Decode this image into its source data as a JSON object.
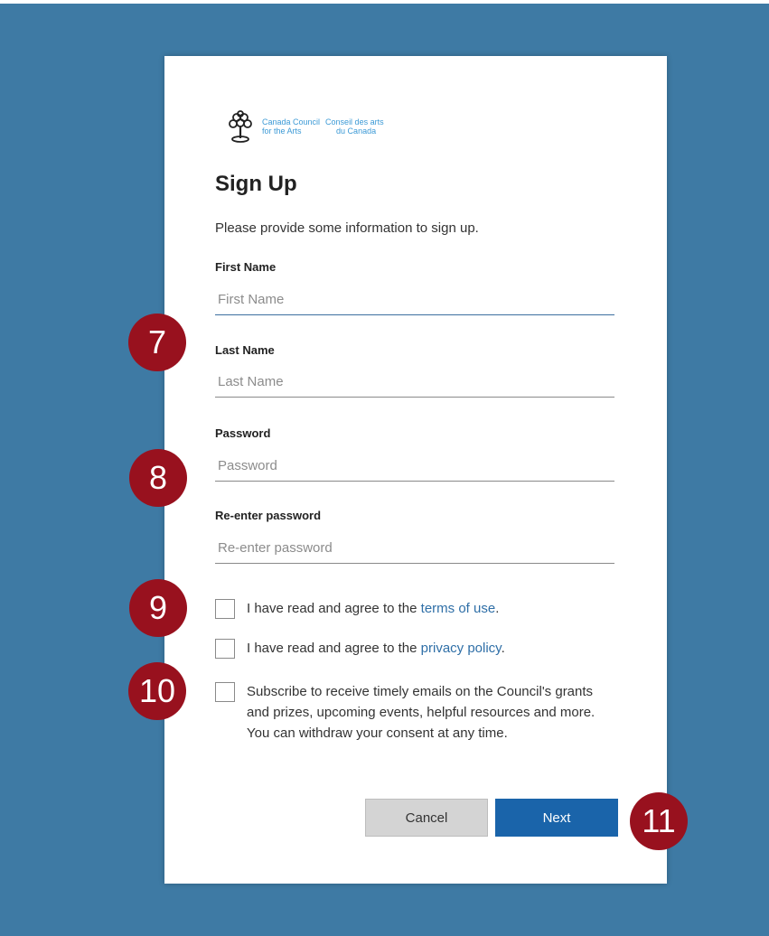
{
  "branding": {
    "logo_text_en_line1": "Canada Council",
    "logo_text_en_line2": "for the Arts",
    "logo_text_fr_line1": "Conseil des arts",
    "logo_text_fr_line2": "du Canada"
  },
  "form": {
    "title": "Sign Up",
    "intro": "Please provide some information to sign up.",
    "first_name": {
      "label": "First Name",
      "placeholder": "First Name",
      "value": ""
    },
    "last_name": {
      "label": "Last Name",
      "placeholder": "Last Name",
      "value": ""
    },
    "password": {
      "label": "Password",
      "placeholder": "Password",
      "value": ""
    },
    "reenter_password": {
      "label": "Re-enter password",
      "placeholder": "Re-enter password",
      "value": ""
    },
    "terms": {
      "prefix": "I have read and agree to the ",
      "link": "terms of use",
      "suffix": ".",
      "checked": false
    },
    "privacy": {
      "prefix": "I have read and agree to the ",
      "link": "privacy policy",
      "suffix": ".",
      "checked": false
    },
    "subscribe": {
      "text": "Subscribe to receive timely emails on the Council's grants and prizes, upcoming events, helpful resources and more. You can withdraw your consent at any time.",
      "checked": false
    },
    "cancel_label": "Cancel",
    "next_label": "Next"
  },
  "markers": [
    "7",
    "8",
    "9",
    "10",
    "11"
  ],
  "colors": {
    "background": "#3e7aa4",
    "primary_button": "#1a64aa",
    "marker": "#98111e",
    "link": "#2f6fa7"
  }
}
